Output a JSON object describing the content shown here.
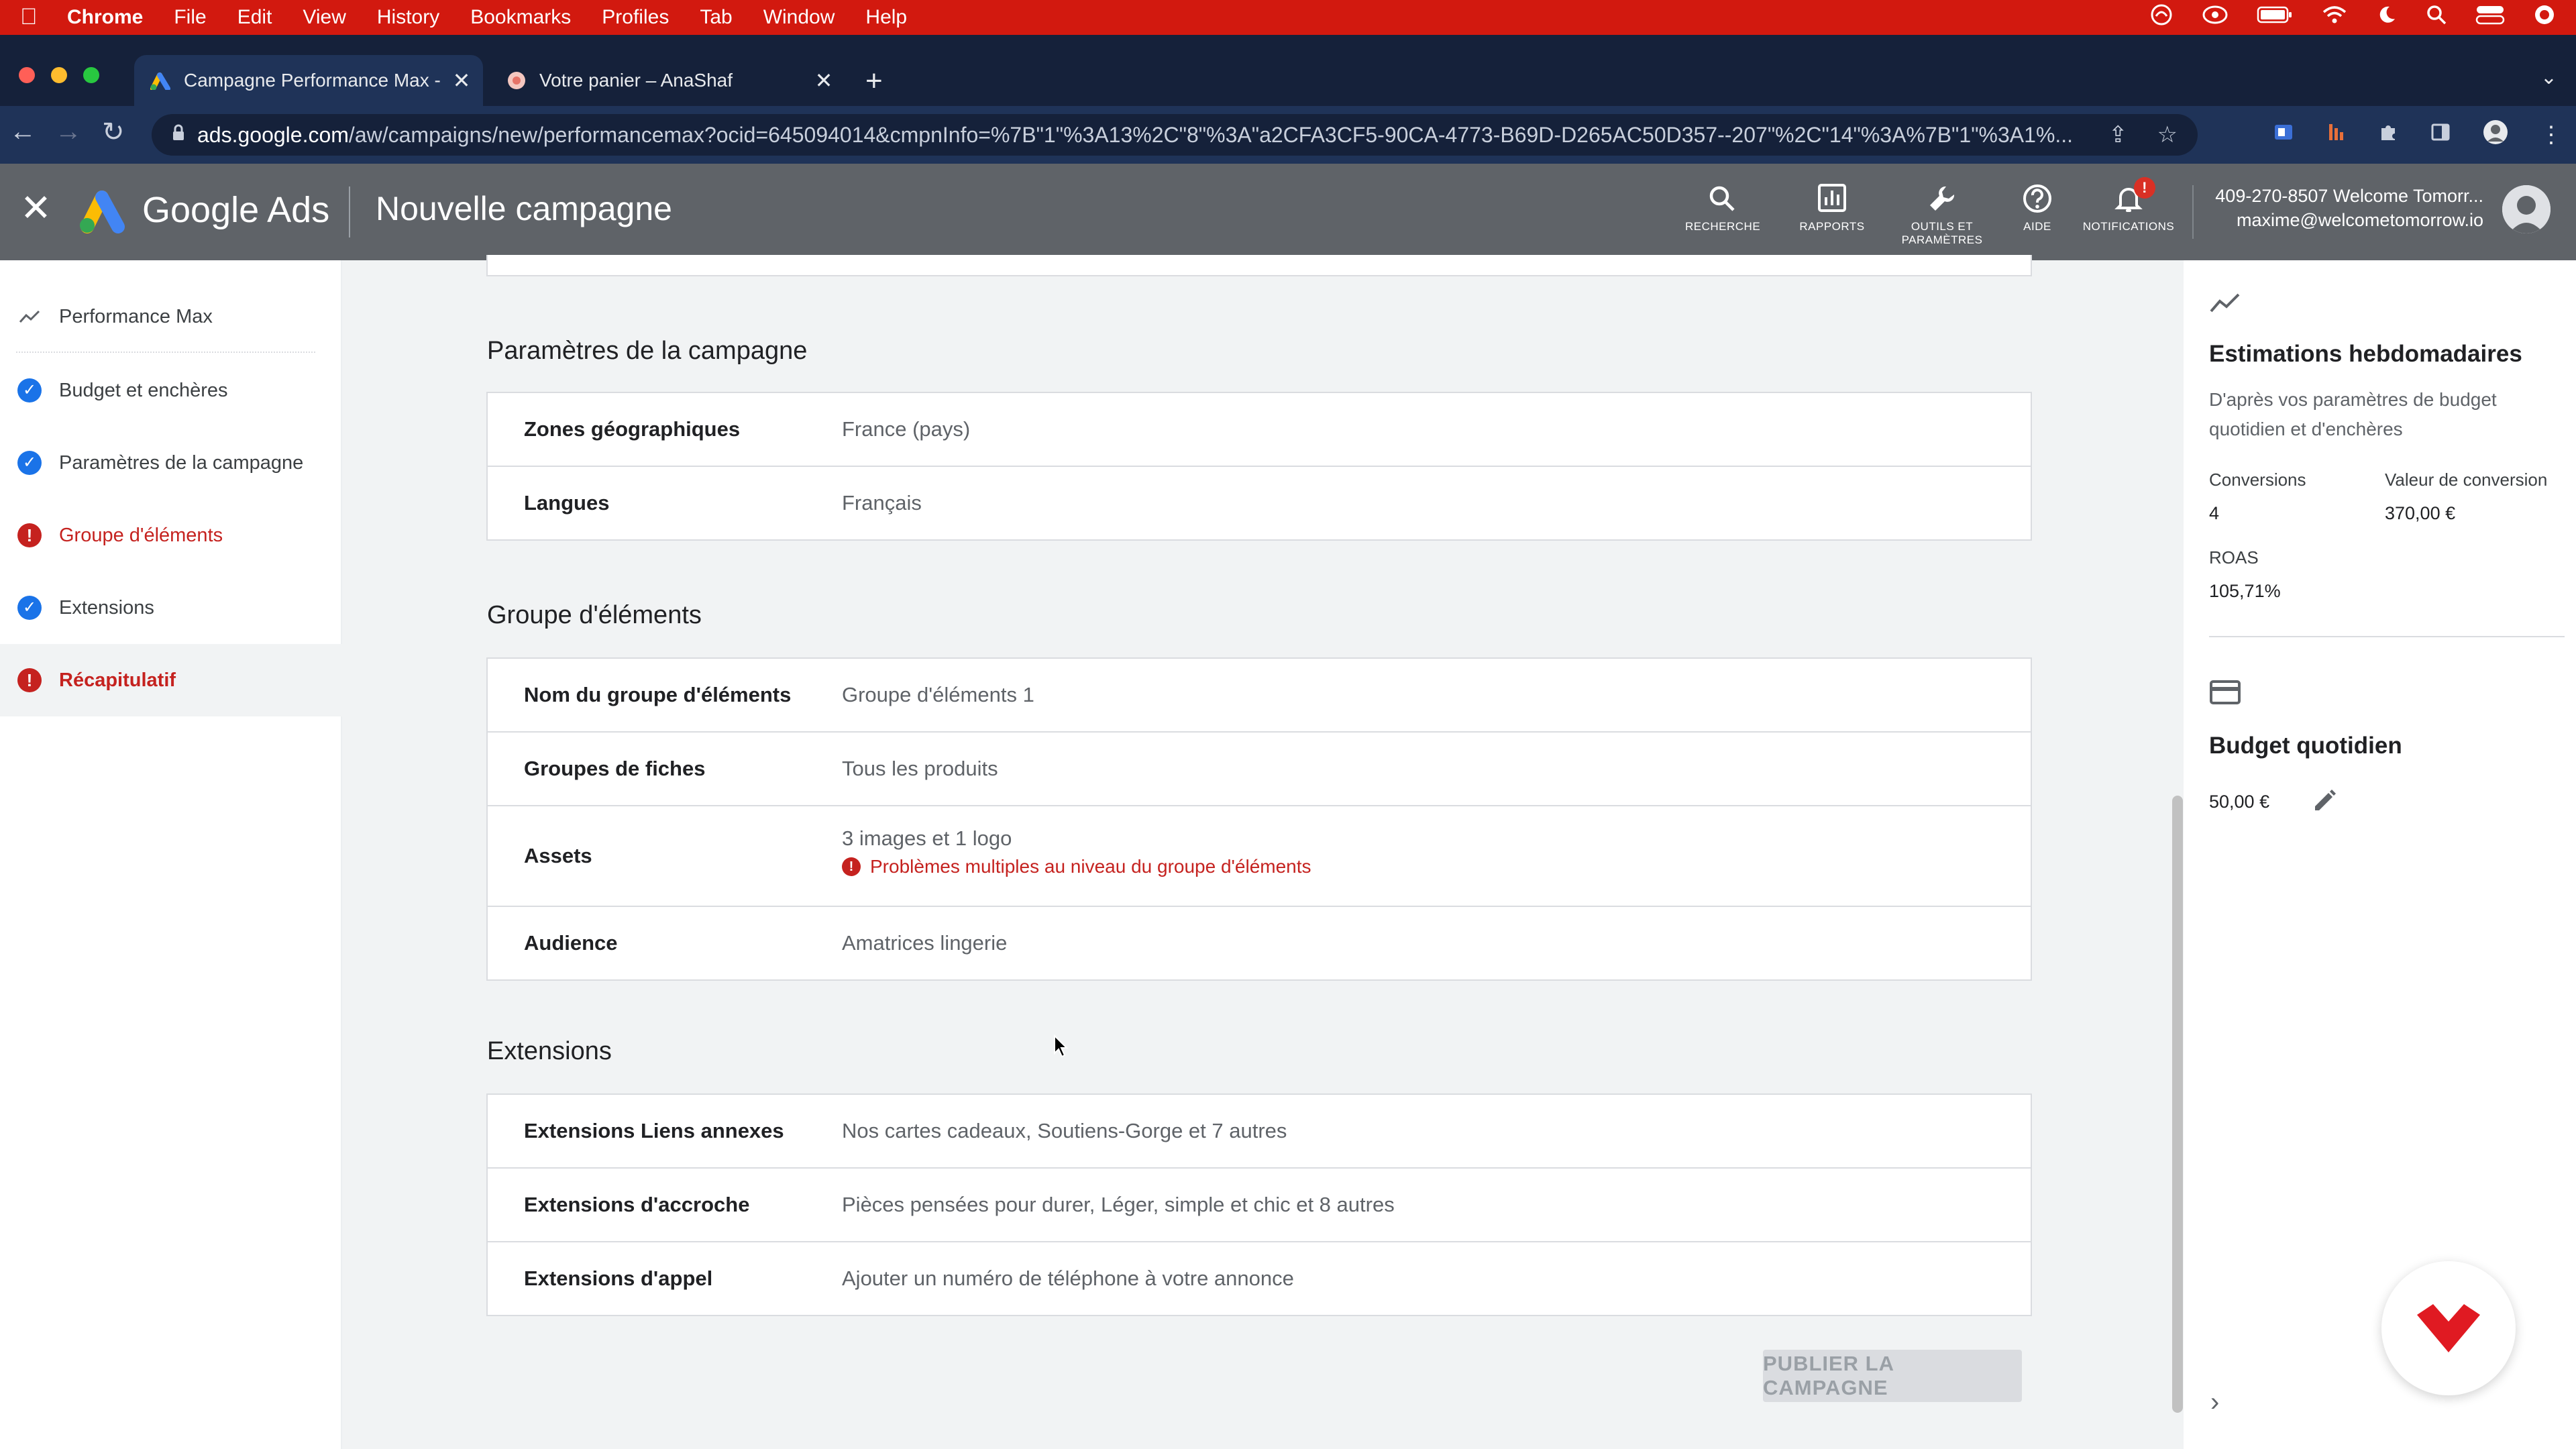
{
  "menubar": {
    "app": "Chrome",
    "items": [
      "File",
      "Edit",
      "View",
      "History",
      "Bookmarks",
      "Profiles",
      "Tab",
      "Window",
      "Help"
    ]
  },
  "tabs": [
    {
      "title": "Campagne Performance Max -",
      "active": true
    },
    {
      "title": "Votre panier – AnaShaf",
      "active": false
    }
  ],
  "address": {
    "host": "ads.google.com",
    "path": "/aw/campaigns/new/performancemax?ocid=645094014&cmpnInfo=%7B\"1\"%3A13%2C\"8\"%3A\"a2CFA3CF5-90CA-4773-B69D-D265AC50D357--207\"%2C\"14\"%3A%7B\"1\"%3A1%..."
  },
  "header": {
    "brand": "Google Ads",
    "page_title": "Nouvelle campagne",
    "buttons": {
      "search": "RECHERCHE",
      "reports": "RAPPORTS",
      "tools_1": "OUTILS ET",
      "tools_2": "PARAMÈTRES",
      "help": "AIDE",
      "notifications": "NOTIFICATIONS"
    },
    "account_line1": "409-270-8507 Welcome Tomorr...",
    "account_line2": "maxime@welcometomorrow.io"
  },
  "nav": {
    "items": [
      {
        "label": "Performance Max",
        "status": "trend"
      },
      {
        "label": "Budget et enchères",
        "status": "ok"
      },
      {
        "label": "Paramètres de la campagne",
        "status": "ok"
      },
      {
        "label": "Groupe d'éléments",
        "status": "error"
      },
      {
        "label": "Extensions",
        "status": "ok"
      },
      {
        "label": "Récapitulatif",
        "status": "error"
      }
    ]
  },
  "sections": {
    "campaign": {
      "title": "Paramètres de la campagne",
      "rows": [
        {
          "label": "Zones géographiques",
          "value": "France (pays)"
        },
        {
          "label": "Langues",
          "value": "Français"
        }
      ]
    },
    "assetgroup": {
      "title": "Groupe d'éléments",
      "rows": [
        {
          "label": "Nom du groupe d'éléments",
          "value": "Groupe d'éléments 1"
        },
        {
          "label": "Groupes de fiches",
          "value": "Tous les produits"
        },
        {
          "label": "Assets",
          "value": "3 images et 1 logo",
          "error": "Problèmes multiples au niveau du groupe d'éléments"
        },
        {
          "label": "Audience",
          "value": "Amatrices lingerie"
        }
      ]
    },
    "extensions": {
      "title": "Extensions",
      "rows": [
        {
          "label": "Extensions Liens annexes",
          "value": "Nos cartes cadeaux, Soutiens-Gorge et 7 autres"
        },
        {
          "label": "Extensions d'accroche",
          "value": "Pièces pensées pour durer, Léger, simple et chic et 8 autres"
        },
        {
          "label": "Extensions d'appel",
          "value": "Ajouter un numéro de téléphone à votre annonce"
        }
      ]
    }
  },
  "publish_label": "PUBLIER LA CAMPAGNE",
  "estimates": {
    "title": "Estimations hebdomadaires",
    "subtitle": "D'après vos paramètres de budget quotidien et d'enchères",
    "conversions_label": "Conversions",
    "conversions_value": "4",
    "conv_value_label": "Valeur de conversion",
    "conv_value_value": "370,00 €",
    "roas_label": "ROAS",
    "roas_value": "105,71%"
  },
  "budget": {
    "title": "Budget quotidien",
    "value": "50,00 €"
  },
  "colors": {
    "menubar": "#d2190f",
    "error": "#c5221f",
    "ok": "#1a73e8",
    "header": "#5f6368"
  }
}
